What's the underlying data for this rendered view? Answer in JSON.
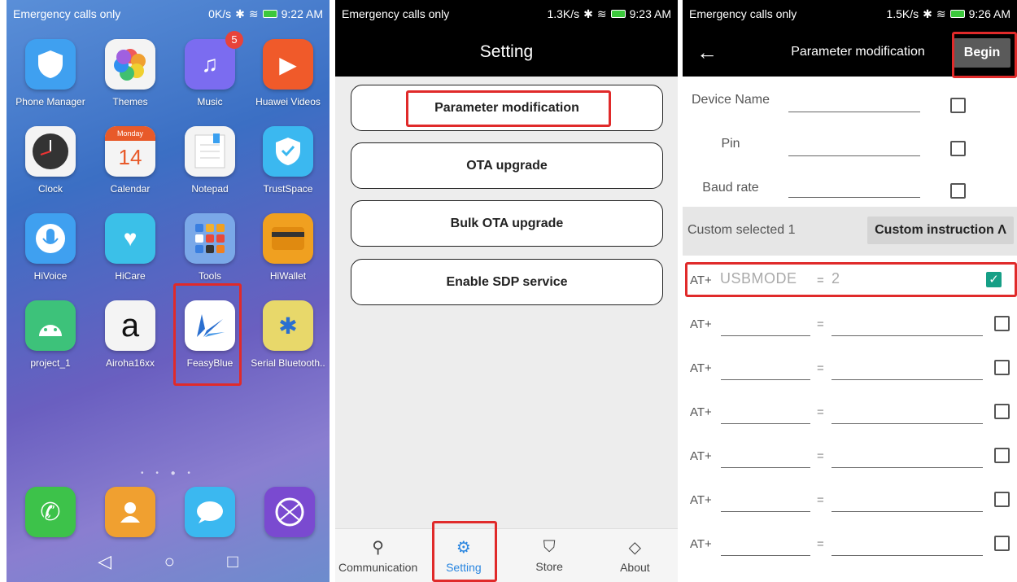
{
  "home": {
    "status": {
      "carrier": "Emergency calls only",
      "speed": "0K/s",
      "time": "9:22 AM"
    },
    "apps": [
      {
        "label": "Phone Manager",
        "color": "#3fa0f0"
      },
      {
        "label": "Themes",
        "color": "#f4f4f4"
      },
      {
        "label": "Music",
        "color": "#7b6cf0",
        "badge": "5"
      },
      {
        "label": "Huawei Videos",
        "color": "#f05a2a"
      },
      {
        "label": "Clock",
        "color": "#f4f4f4"
      },
      {
        "label": "Calendar",
        "color": "#f4f4f4",
        "day": "Monday",
        "date": "14"
      },
      {
        "label": "Notepad",
        "color": "#f4f4f4"
      },
      {
        "label": "TrustSpace",
        "color": "#3bb8f0"
      },
      {
        "label": "HiVoice",
        "color": "#3fa0f0"
      },
      {
        "label": "HiCare",
        "color": "#3bc0e8"
      },
      {
        "label": "Tools",
        "color": "#7aa8e8"
      },
      {
        "label": "HiWallet",
        "color": "#f0a020"
      },
      {
        "label": "project_1",
        "color": "#3dc27a"
      },
      {
        "label": "Airoha16xx",
        "color": "#f4f4f4"
      },
      {
        "label": "FeasyBlue",
        "color": "#ffffff"
      },
      {
        "label": "Serial Bluetooth..",
        "color": "#e8d86a"
      }
    ],
    "dock": [
      "phone-icon",
      "contacts-icon",
      "messages-icon",
      "browser-icon"
    ]
  },
  "setting": {
    "status": {
      "carrier": "Emergency calls only",
      "speed": "1.3K/s",
      "time": "9:23 AM"
    },
    "title": "Setting",
    "buttons": [
      "Parameter modification",
      "OTA upgrade",
      "Bulk OTA upgrade",
      "Enable SDP service"
    ],
    "nav": [
      "Communication",
      "Setting",
      "Store",
      "About"
    ]
  },
  "param": {
    "status": {
      "carrier": "Emergency calls only",
      "speed": "1.5K/s",
      "time": "9:26 AM"
    },
    "title": "Parameter modification",
    "begin": "Begin",
    "fields": [
      "Device Name",
      "Pin",
      "Baud rate"
    ],
    "custom_selected": "Custom selected 1",
    "custom_instruction": "Custom instruction Λ",
    "at_prefix": "AT+",
    "eq": "=",
    "first_cmd": {
      "name": "USBMODE",
      "value": "2"
    }
  }
}
